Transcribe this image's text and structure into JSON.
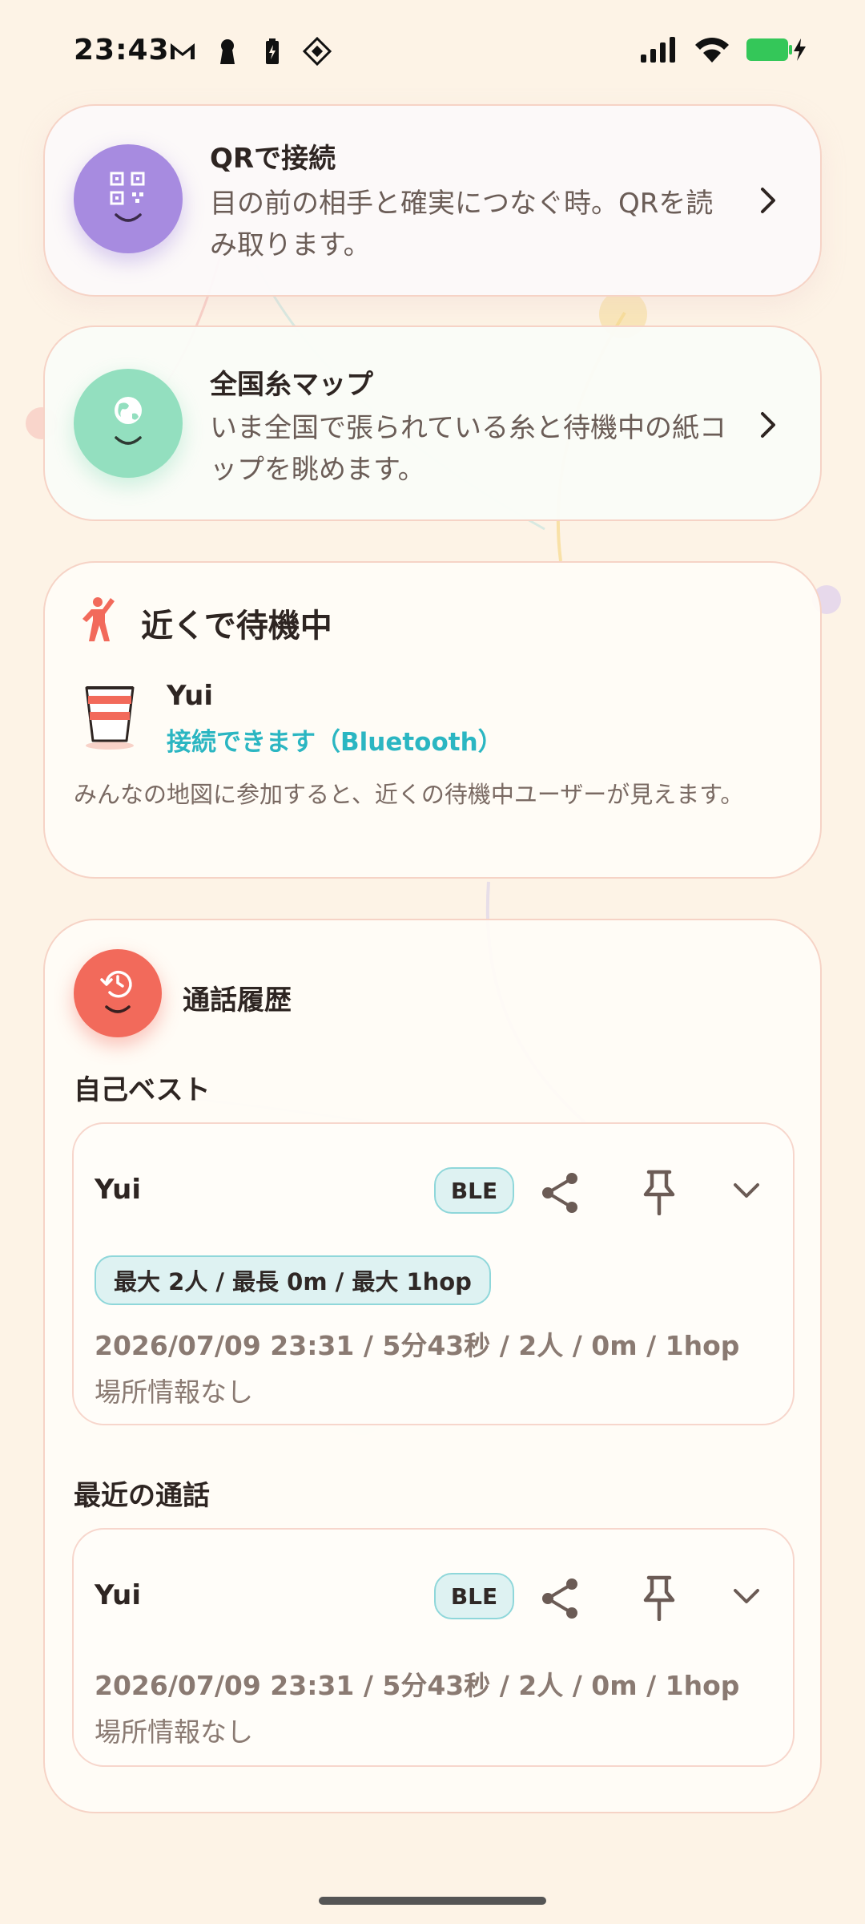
{
  "status_bar": {
    "time": "23:43",
    "left_icons": [
      "gmail-icon",
      "keyhole-icon",
      "battery-saver-icon",
      "app-icon"
    ],
    "right_icons": [
      "signal-icon",
      "wifi-icon",
      "battery-charging-icon"
    ]
  },
  "qr_card": {
    "title": "QRで接続",
    "description": "目の前の相手と確実につなぐ時。QRを読み取ります。",
    "icon": "qr-code-icon",
    "accent": "#a78be0"
  },
  "map_card": {
    "title": "全国糸マップ",
    "description": "いま全国で張られている糸と待機中の紙コップを眺めます。",
    "icon": "globe-icon",
    "accent": "#93dfbf"
  },
  "nearby": {
    "title": "近くで待機中",
    "icon": "person-waving-icon",
    "user_name": "Yui",
    "user_status": "接続できます（Bluetooth）",
    "hint": "みんなの地図に参加すると、近くの待機中ユーザーが見えます。",
    "status_color": "#2bb6c2"
  },
  "history": {
    "title": "通話履歴",
    "icon": "history-icon",
    "accent": "#f26a5b",
    "best_label": "自己ベスト",
    "recent_label": "最近の通話",
    "best_call": {
      "user": "Yui",
      "badge": "BLE",
      "stats": "最大 2人 / 最長 0m / 最大 1hop",
      "detail": "2026/07/09 23:31 / 5分43秒 / 2人 / 0m / 1hop",
      "location": "場所情報なし"
    },
    "recent_call": {
      "user": "Yui",
      "badge": "BLE",
      "detail": "2026/07/09 23:31 / 5分43秒 / 2人 / 0m / 1hop",
      "location": "場所情報なし"
    }
  }
}
